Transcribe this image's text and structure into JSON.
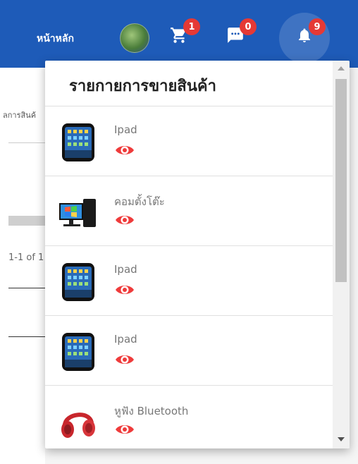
{
  "header": {
    "home_label": "หน้าหลัก",
    "cart_count": "1",
    "messages_count": "0",
    "notifications_count": "9",
    "bar_color": "#1e5bb8",
    "badge_color": "#e53935"
  },
  "background": {
    "partial_text": "ลการสินค้",
    "pager_text": "1-1 of 1"
  },
  "dropdown": {
    "title": "รายกายการขายสินค้า",
    "items": [
      {
        "label": "Ipad",
        "thumb": "ipad-icon"
      },
      {
        "label": "คอมตั้งโต๊ะ",
        "thumb": "desktop-computer-icon"
      },
      {
        "label": "Ipad",
        "thumb": "ipad-icon"
      },
      {
        "label": "Ipad",
        "thumb": "ipad-icon"
      },
      {
        "label": "หูฟัง Bluetooth",
        "thumb": "headphones-icon"
      }
    ],
    "eye_color": "#ef3b3b"
  }
}
